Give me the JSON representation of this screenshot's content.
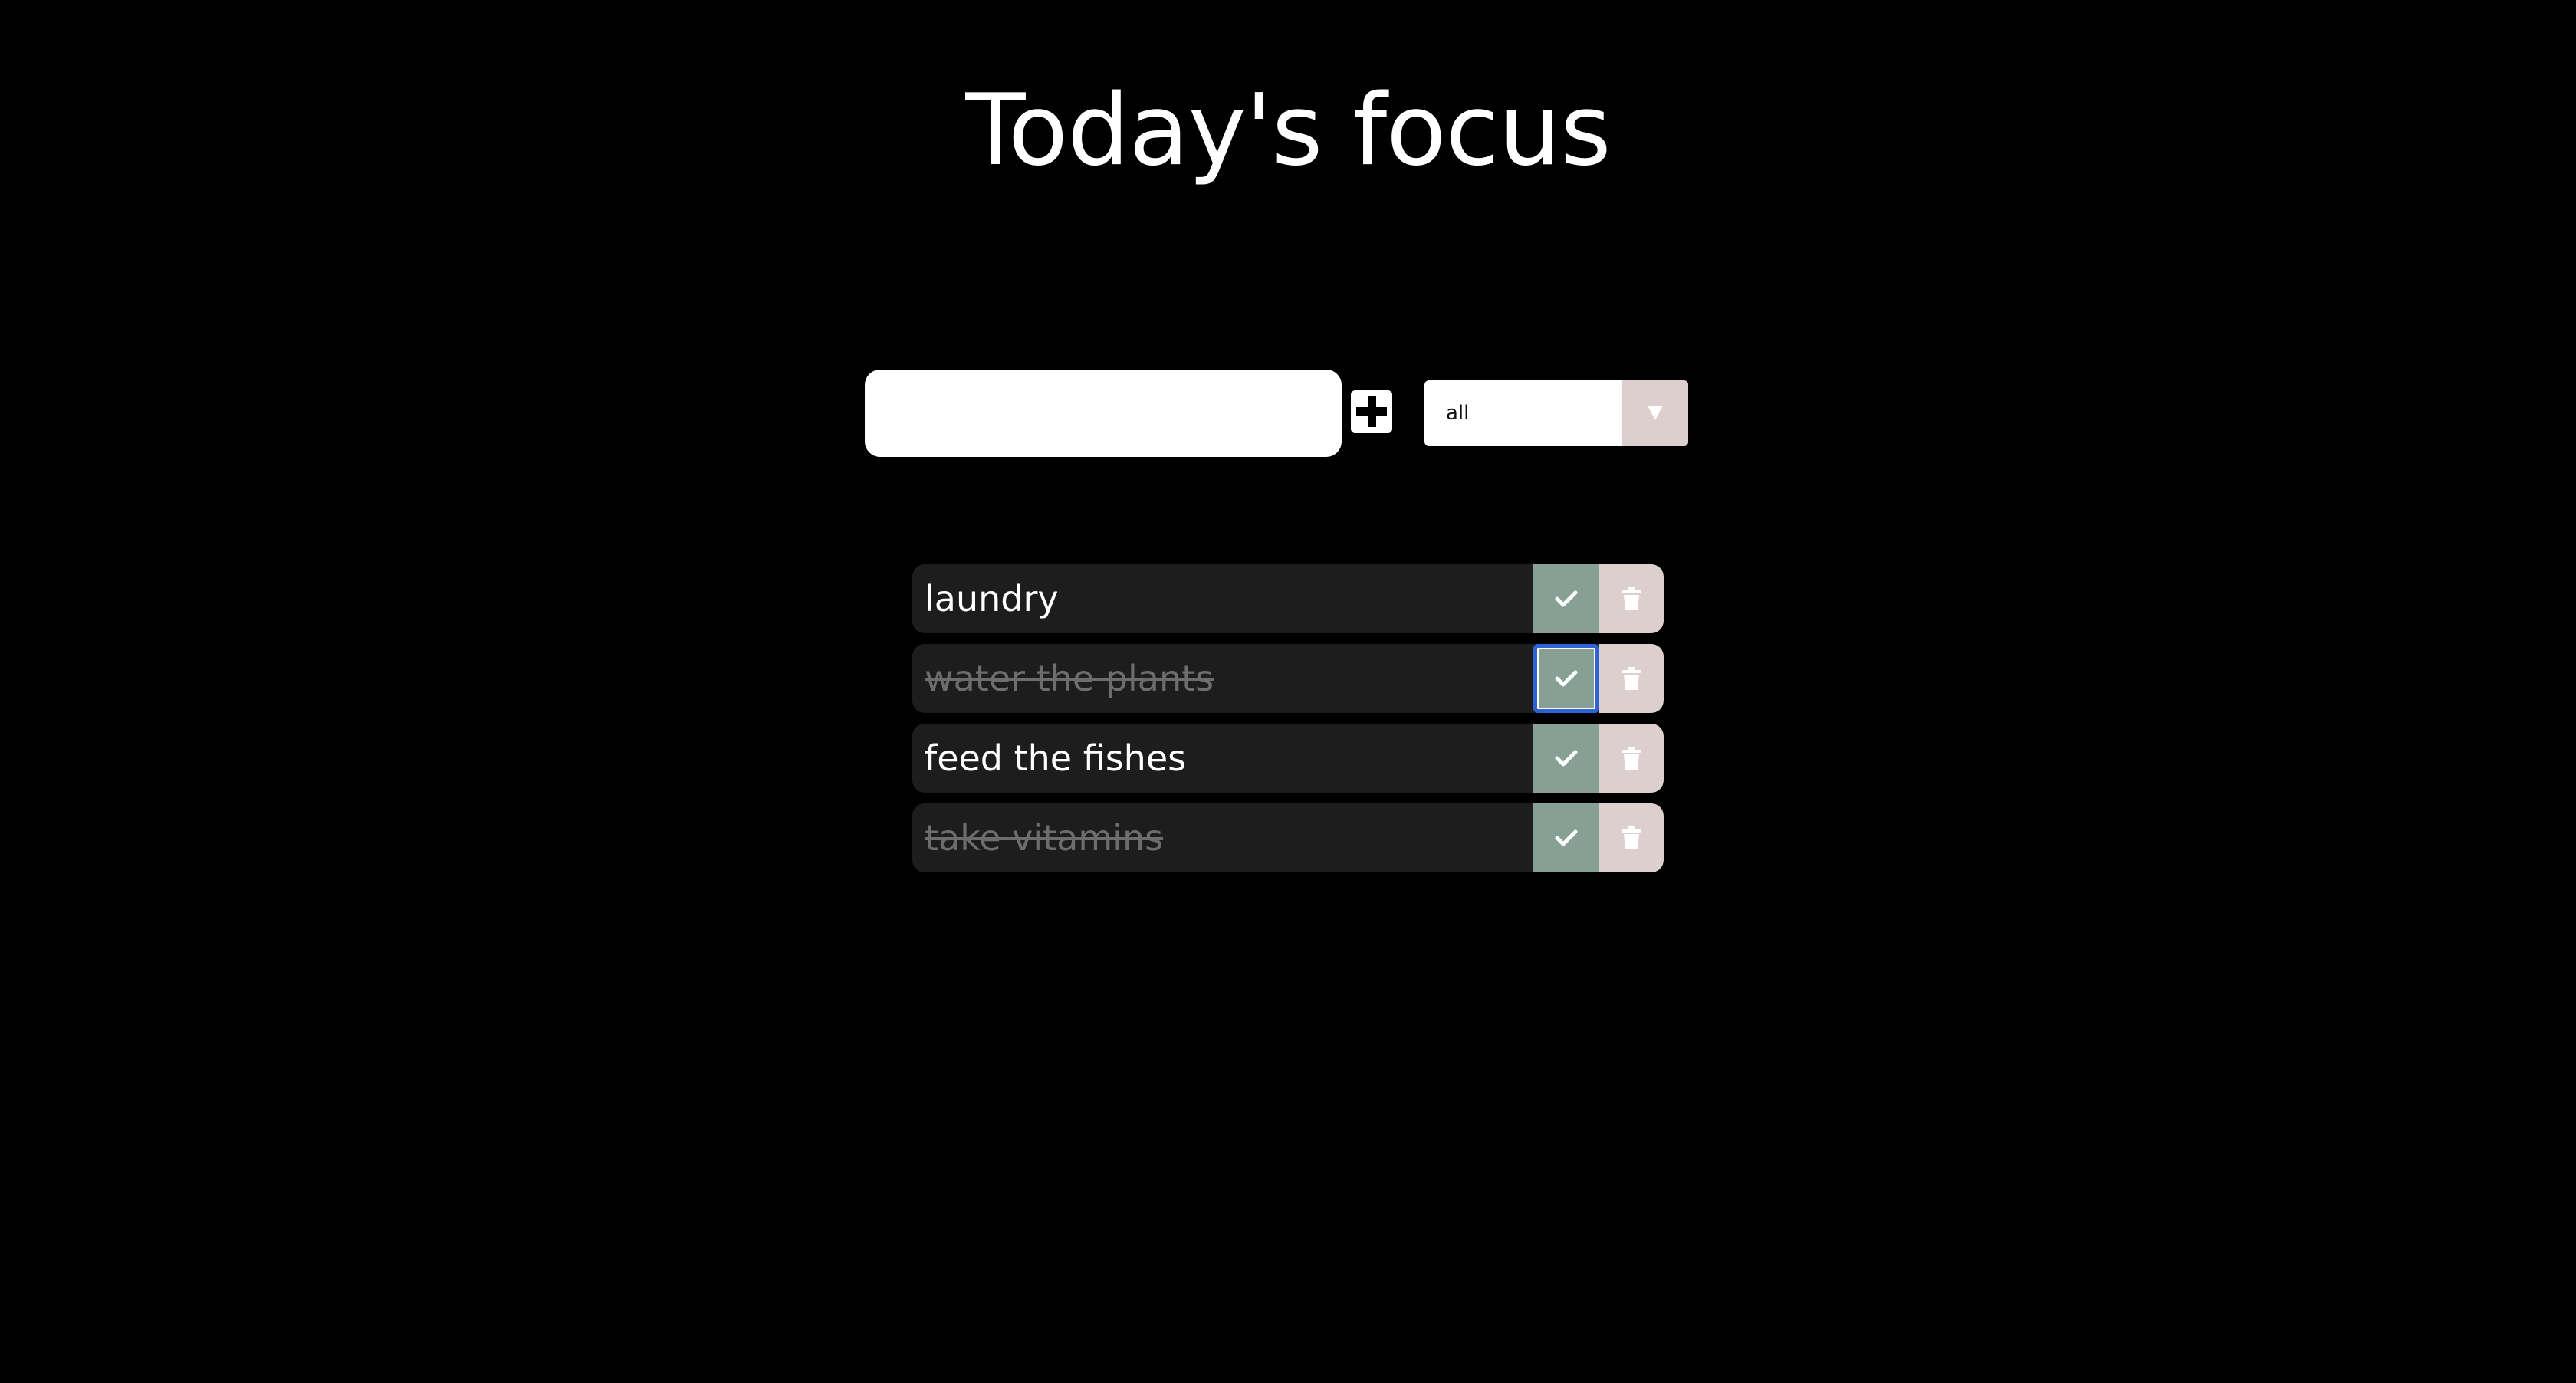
{
  "app": {
    "title": "Today's focus"
  },
  "controls": {
    "input_value": "",
    "input_placeholder": "",
    "add_icon": "plus-square-icon",
    "filter_selected": "all"
  },
  "todos": [
    {
      "text": "laundry",
      "completed": false
    },
    {
      "text": "water the plants",
      "completed": true
    },
    {
      "text": "feed the fishes",
      "completed": false
    },
    {
      "text": "take vitamins",
      "completed": true
    }
  ],
  "colors": {
    "background": "#000000",
    "item_background": "#1d1d1d",
    "check_button": "#87a096",
    "trash_button": "#dccfcd",
    "completed_text": "#6d6d6d",
    "focus_ring": "#2d63d6"
  }
}
